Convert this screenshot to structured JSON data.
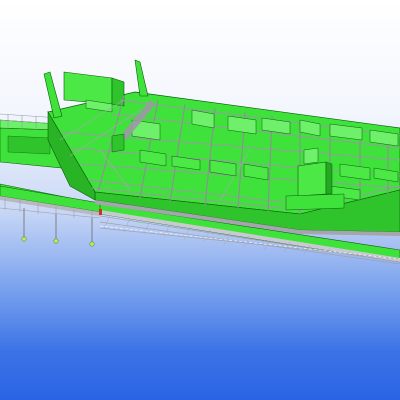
{
  "view": {
    "title": "",
    "background_top": "#ffffff",
    "background_bottom": "#2a64e4",
    "colors": {
      "hull": "#3fe23a",
      "hull_light": "#6ff06a",
      "hull_dark": "#1fa51c",
      "beam": "#9a9aa3",
      "edge": "#0d5e0d",
      "walkway": "#b9b9c2",
      "flange": "#d03020"
    }
  }
}
